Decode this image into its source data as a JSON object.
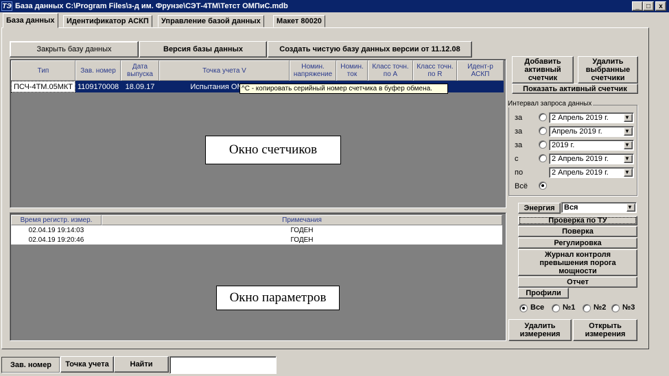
{
  "window": {
    "title": "База данных C:\\Program Files\\з-д им. Фрунзе\\СЭТ-4ТМ\\Тетст ОМПиС.mdb",
    "app_icon": "ТЭ",
    "minimize": "_",
    "maximize": "□",
    "close": "x"
  },
  "tabs": [
    {
      "label": "База данных",
      "active": true
    },
    {
      "label": "Идентификатор АСКП",
      "active": false
    },
    {
      "label": "Управление базой данных",
      "active": false
    },
    {
      "label": "Макет 80020",
      "active": false
    }
  ],
  "toolbar": {
    "close_db": "Закрыть базу данных",
    "db_version": "Версия базы данных",
    "create_clean": "Создать чистую базу данных версии от 11.12.08"
  },
  "meters_table": {
    "columns": [
      "Тип",
      "Зав. номер",
      "Дата выпуска",
      "Точка учета V",
      "Номин. напряжение",
      "Номин. ток",
      "Класс точн. по А",
      "Класс точн. по R",
      "Идент-р АСКП"
    ],
    "rows": [
      {
        "type": "ПСЧ-4ТМ.05МКТ",
        "serial": "1109170008",
        "date": "18.09.17",
        "point": "Испытания ОМПиС"
      }
    ],
    "tooltip": "^C - копировать серийный номер счетчика в буфер обмена.",
    "overlay_label": "Окно счетчиков"
  },
  "params_table": {
    "columns": [
      "Время регистр. измер.",
      "Примечания"
    ],
    "rows": [
      {
        "time": "02.04.19 19:14:03",
        "note": "ГОДЕН"
      },
      {
        "time": "02.04.19 19:20:46",
        "note": "ГОДЕН"
      }
    ],
    "overlay_label": "Окно параметров"
  },
  "right_panel": {
    "add_active": "Добавить активный счетчик",
    "delete_selected": "Удалить выбранные счетчики",
    "show_active": "Показать активный счетчик",
    "interval_group": "Интервал запроса данных",
    "interval_rows": [
      {
        "label": "за",
        "value": "2 Апрель 2019 г.",
        "selected": false
      },
      {
        "label": "за",
        "value": "Апрель 2019 г.",
        "selected": false
      },
      {
        "label": "за",
        "value": "2019 г.",
        "selected": false
      },
      {
        "label": "с",
        "value": "2 Апрель 2019 г.",
        "selected": false
      },
      {
        "label": "по",
        "value": "2 Апрель 2019 г.",
        "selected": false
      }
    ],
    "all_label": "Всё",
    "all_selected": true,
    "energy_label": "Энергия",
    "energy_value": "Вся",
    "check_tu": "Проверка по ТУ",
    "verification": "Поверка",
    "adjustment": "Регулировка",
    "journal": "Журнал контроля превышения порога мощности",
    "report": "Отчет",
    "profiles": "Профили",
    "profile_options": [
      {
        "label": "Все",
        "selected": true
      },
      {
        "label": "№1",
        "selected": false
      },
      {
        "label": "№2",
        "selected": false
      },
      {
        "label": "№3",
        "selected": false
      }
    ],
    "delete_measurements": "Удалить измерения",
    "open_measurements": "Открыть измерения"
  },
  "bottom": {
    "tab_serial": "Зав. номер",
    "tab_point": "Точка учета",
    "find": "Найти",
    "search_value": ""
  },
  "colors": {
    "title_bar": "#0a246a",
    "selection": "#0a246a",
    "panel_dark": "#808080",
    "face": "#d4d0c8",
    "tooltip_bg": "#ffffe1"
  }
}
